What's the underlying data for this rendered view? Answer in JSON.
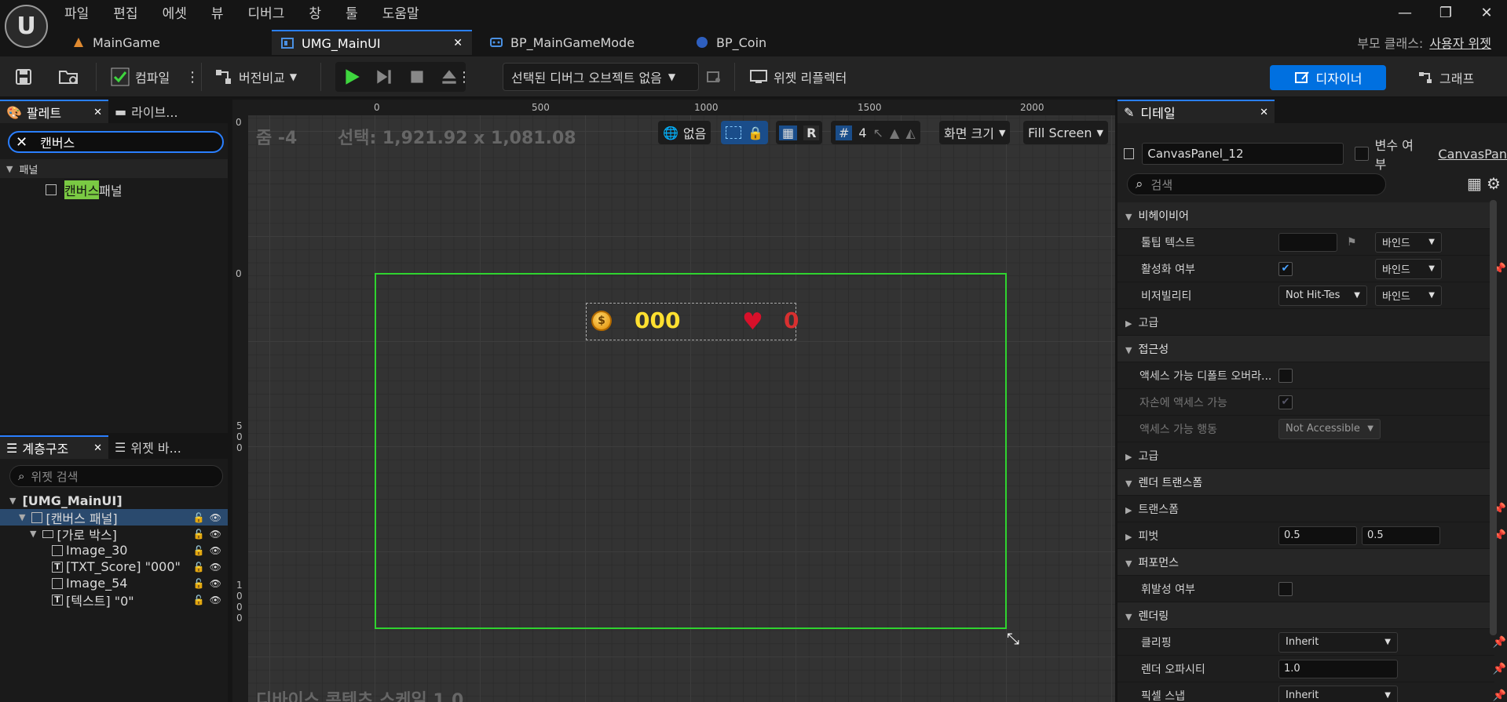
{
  "menu": [
    "파일",
    "편집",
    "에셋",
    "뷰",
    "디버그",
    "창",
    "툴",
    "도움말"
  ],
  "tabs": [
    {
      "label": "MainGame"
    },
    {
      "label": "UMG_MainUI"
    },
    {
      "label": "BP_MainGameMode"
    },
    {
      "label": "BP_Coin"
    }
  ],
  "window": {
    "minimize": "—",
    "restore": "❐",
    "close": "✕"
  },
  "parent_class": {
    "label": "부모 클래스:",
    "value": "사용자 위젯"
  },
  "toolbar": {
    "compile": "컴파일",
    "diff": "버전비교",
    "debug_object": "선택된 디버그 오브젝트 없음",
    "widget_reflector": "위젯 리플렉터",
    "designer": "디자이너",
    "graph": "그래프"
  },
  "palette": {
    "tab1": "팔레트",
    "tab2": "라이브...",
    "search_value": "캔버스",
    "category": "패널",
    "item_highlight": "캔버스",
    "item_rest": " 패널"
  },
  "hierarchy": {
    "tab1": "계층구조",
    "tab2": "위젯 바...",
    "search_placeholder": "위젯 검색",
    "root": "[UMG_MainUI]",
    "items": [
      {
        "label": "[캔버스 패널]"
      },
      {
        "label": "[가로 박스]"
      },
      {
        "label": "Image_30"
      },
      {
        "label": "[TXT_Score] \"000\""
      },
      {
        "label": "Image_54"
      },
      {
        "label": "[텍스트] \"0\""
      }
    ]
  },
  "viewport": {
    "zoom": "줌 -4",
    "selection": "선택: 1,921.92 x 1,081.08",
    "dpi": "디바이스 콘텐츠 스케일 1.0",
    "none": "없음",
    "r": "R",
    "grid": "4",
    "screen_size": "화면 크기",
    "fill": "Fill Screen",
    "ruler_top": [
      "0",
      "500",
      "1000",
      "1500",
      "2000"
    ],
    "ruler_left_0": "0",
    "ruler_left_top": "0",
    "ruler_left_500": "5\n0\n0",
    "ruler_left_1000": "1\n0\n0\n0",
    "hud_score": "000",
    "hud_count": "0",
    "coin_symbol": "$"
  },
  "details": {
    "tab": "디테일",
    "name": "CanvasPanel_12",
    "is_variable": "변수 여부",
    "class_link": "CanvasPan",
    "search_placeholder": "검색",
    "behavior": "비헤이비어",
    "tooltip": "툴팁 텍스트",
    "bind": "바인드",
    "enabled": "활성화 여부",
    "visibility": "비저빌리티",
    "visibility_value": "Not Hit-Tes",
    "advanced": "고급",
    "accessibility": "접근성",
    "access_default": "액세스 가능 디폴트 오버라...",
    "access_children": "자손에 액세스 가능",
    "access_behavior": "액세스 가능 행동",
    "access_behavior_value": "Not Accessible",
    "render_transform": "렌더 트랜스폼",
    "transform": "트랜스폼",
    "pivot": "피벗",
    "pivot_x": "0.5",
    "pivot_y": "0.5",
    "performance": "퍼포먼스",
    "volatile": "휘발성 여부",
    "rendering": "렌더링",
    "clipping": "클리핑",
    "clipping_value": "Inherit",
    "opacity": "렌더 오파시티",
    "opacity_value": "1.0",
    "pixel_snap": "픽셀 스냅",
    "pixel_snap_value": "Inherit"
  }
}
